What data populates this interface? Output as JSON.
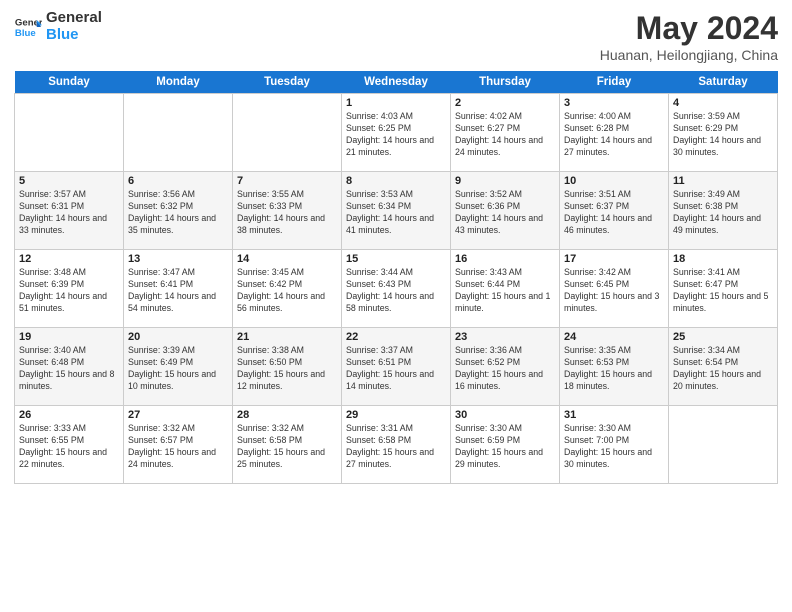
{
  "header": {
    "logo_line1": "General",
    "logo_line2": "Blue",
    "month_year": "May 2024",
    "location": "Huanan, Heilongjiang, China"
  },
  "days_of_week": [
    "Sunday",
    "Monday",
    "Tuesday",
    "Wednesday",
    "Thursday",
    "Friday",
    "Saturday"
  ],
  "weeks": [
    [
      {
        "day": "",
        "sunrise": "",
        "sunset": "",
        "daylight": ""
      },
      {
        "day": "",
        "sunrise": "",
        "sunset": "",
        "daylight": ""
      },
      {
        "day": "",
        "sunrise": "",
        "sunset": "",
        "daylight": ""
      },
      {
        "day": "1",
        "sunrise": "Sunrise: 4:03 AM",
        "sunset": "Sunset: 6:25 PM",
        "daylight": "Daylight: 14 hours and 21 minutes."
      },
      {
        "day": "2",
        "sunrise": "Sunrise: 4:02 AM",
        "sunset": "Sunset: 6:27 PM",
        "daylight": "Daylight: 14 hours and 24 minutes."
      },
      {
        "day": "3",
        "sunrise": "Sunrise: 4:00 AM",
        "sunset": "Sunset: 6:28 PM",
        "daylight": "Daylight: 14 hours and 27 minutes."
      },
      {
        "day": "4",
        "sunrise": "Sunrise: 3:59 AM",
        "sunset": "Sunset: 6:29 PM",
        "daylight": "Daylight: 14 hours and 30 minutes."
      }
    ],
    [
      {
        "day": "5",
        "sunrise": "Sunrise: 3:57 AM",
        "sunset": "Sunset: 6:31 PM",
        "daylight": "Daylight: 14 hours and 33 minutes."
      },
      {
        "day": "6",
        "sunrise": "Sunrise: 3:56 AM",
        "sunset": "Sunset: 6:32 PM",
        "daylight": "Daylight: 14 hours and 35 minutes."
      },
      {
        "day": "7",
        "sunrise": "Sunrise: 3:55 AM",
        "sunset": "Sunset: 6:33 PM",
        "daylight": "Daylight: 14 hours and 38 minutes."
      },
      {
        "day": "8",
        "sunrise": "Sunrise: 3:53 AM",
        "sunset": "Sunset: 6:34 PM",
        "daylight": "Daylight: 14 hours and 41 minutes."
      },
      {
        "day": "9",
        "sunrise": "Sunrise: 3:52 AM",
        "sunset": "Sunset: 6:36 PM",
        "daylight": "Daylight: 14 hours and 43 minutes."
      },
      {
        "day": "10",
        "sunrise": "Sunrise: 3:51 AM",
        "sunset": "Sunset: 6:37 PM",
        "daylight": "Daylight: 14 hours and 46 minutes."
      },
      {
        "day": "11",
        "sunrise": "Sunrise: 3:49 AM",
        "sunset": "Sunset: 6:38 PM",
        "daylight": "Daylight: 14 hours and 49 minutes."
      }
    ],
    [
      {
        "day": "12",
        "sunrise": "Sunrise: 3:48 AM",
        "sunset": "Sunset: 6:39 PM",
        "daylight": "Daylight: 14 hours and 51 minutes."
      },
      {
        "day": "13",
        "sunrise": "Sunrise: 3:47 AM",
        "sunset": "Sunset: 6:41 PM",
        "daylight": "Daylight: 14 hours and 54 minutes."
      },
      {
        "day": "14",
        "sunrise": "Sunrise: 3:45 AM",
        "sunset": "Sunset: 6:42 PM",
        "daylight": "Daylight: 14 hours and 56 minutes."
      },
      {
        "day": "15",
        "sunrise": "Sunrise: 3:44 AM",
        "sunset": "Sunset: 6:43 PM",
        "daylight": "Daylight: 14 hours and 58 minutes."
      },
      {
        "day": "16",
        "sunrise": "Sunrise: 3:43 AM",
        "sunset": "Sunset: 6:44 PM",
        "daylight": "Daylight: 15 hours and 1 minute."
      },
      {
        "day": "17",
        "sunrise": "Sunrise: 3:42 AM",
        "sunset": "Sunset: 6:45 PM",
        "daylight": "Daylight: 15 hours and 3 minutes."
      },
      {
        "day": "18",
        "sunrise": "Sunrise: 3:41 AM",
        "sunset": "Sunset: 6:47 PM",
        "daylight": "Daylight: 15 hours and 5 minutes."
      }
    ],
    [
      {
        "day": "19",
        "sunrise": "Sunrise: 3:40 AM",
        "sunset": "Sunset: 6:48 PM",
        "daylight": "Daylight: 15 hours and 8 minutes."
      },
      {
        "day": "20",
        "sunrise": "Sunrise: 3:39 AM",
        "sunset": "Sunset: 6:49 PM",
        "daylight": "Daylight: 15 hours and 10 minutes."
      },
      {
        "day": "21",
        "sunrise": "Sunrise: 3:38 AM",
        "sunset": "Sunset: 6:50 PM",
        "daylight": "Daylight: 15 hours and 12 minutes."
      },
      {
        "day": "22",
        "sunrise": "Sunrise: 3:37 AM",
        "sunset": "Sunset: 6:51 PM",
        "daylight": "Daylight: 15 hours and 14 minutes."
      },
      {
        "day": "23",
        "sunrise": "Sunrise: 3:36 AM",
        "sunset": "Sunset: 6:52 PM",
        "daylight": "Daylight: 15 hours and 16 minutes."
      },
      {
        "day": "24",
        "sunrise": "Sunrise: 3:35 AM",
        "sunset": "Sunset: 6:53 PM",
        "daylight": "Daylight: 15 hours and 18 minutes."
      },
      {
        "day": "25",
        "sunrise": "Sunrise: 3:34 AM",
        "sunset": "Sunset: 6:54 PM",
        "daylight": "Daylight: 15 hours and 20 minutes."
      }
    ],
    [
      {
        "day": "26",
        "sunrise": "Sunrise: 3:33 AM",
        "sunset": "Sunset: 6:55 PM",
        "daylight": "Daylight: 15 hours and 22 minutes."
      },
      {
        "day": "27",
        "sunrise": "Sunrise: 3:32 AM",
        "sunset": "Sunset: 6:57 PM",
        "daylight": "Daylight: 15 hours and 24 minutes."
      },
      {
        "day": "28",
        "sunrise": "Sunrise: 3:32 AM",
        "sunset": "Sunset: 6:58 PM",
        "daylight": "Daylight: 15 hours and 25 minutes."
      },
      {
        "day": "29",
        "sunrise": "Sunrise: 3:31 AM",
        "sunset": "Sunset: 6:58 PM",
        "daylight": "Daylight: 15 hours and 27 minutes."
      },
      {
        "day": "30",
        "sunrise": "Sunrise: 3:30 AM",
        "sunset": "Sunset: 6:59 PM",
        "daylight": "Daylight: 15 hours and 29 minutes."
      },
      {
        "day": "31",
        "sunrise": "Sunrise: 3:30 AM",
        "sunset": "Sunset: 7:00 PM",
        "daylight": "Daylight: 15 hours and 30 minutes."
      },
      {
        "day": "",
        "sunrise": "",
        "sunset": "",
        "daylight": ""
      }
    ]
  ]
}
